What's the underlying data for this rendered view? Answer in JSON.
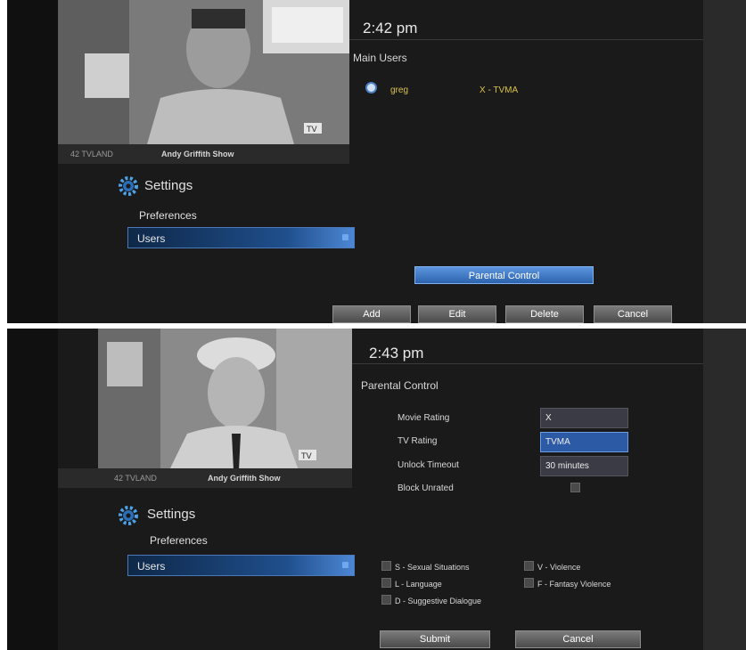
{
  "screen1": {
    "channel": "42 TVLAND",
    "show": "Andy Griffith Show",
    "tv_badge": "TV",
    "time": "2:42 pm",
    "section_title": "Main Users",
    "user": {
      "name": "greg",
      "rating": "X - TVMA"
    },
    "menu": {
      "title": "Settings",
      "subtitle": "Preferences",
      "selected": "Users"
    },
    "parental_control_label": "Parental Control",
    "buttons": [
      "Add",
      "Edit",
      "Delete",
      "Cancel"
    ]
  },
  "screen2": {
    "channel": "42 TVLAND",
    "show": "Andy Griffith Show",
    "tv_badge": "TV",
    "time": "2:43 pm",
    "section_title": "Parental Control",
    "menu": {
      "title": "Settings",
      "subtitle": "Preferences",
      "selected": "Users"
    },
    "fields": [
      {
        "label": "Movie Rating",
        "value": "X"
      },
      {
        "label": "TV Rating",
        "value": "TVMA"
      },
      {
        "label": "Unlock Timeout",
        "value": "30 minutes"
      },
      {
        "label": "Block Unrated"
      }
    ],
    "content_flags": [
      "S - Sexual Situations",
      "V - Violence",
      "L - Language",
      "F - Fantasy Violence",
      "D - Suggestive Dialogue"
    ],
    "buttons": [
      "Submit",
      "Cancel"
    ]
  },
  "colors": {
    "accent_blue": "#2c5aa5",
    "highlight_yellow": "#d9c24a",
    "background": "#1a1a1a"
  }
}
